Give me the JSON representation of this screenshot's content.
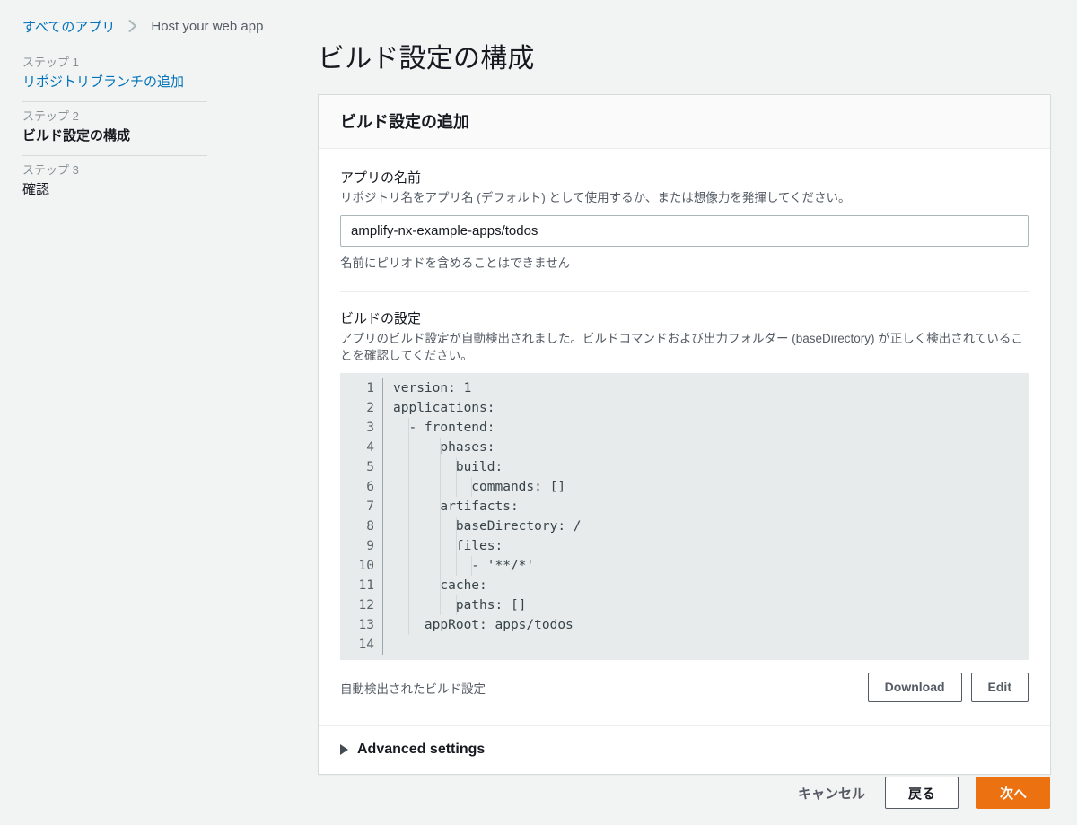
{
  "breadcrumb": {
    "root_label": "すべてのアプリ",
    "separator_icon": "chevron-right-icon",
    "current_label": "Host your web app"
  },
  "sidebar": {
    "steps": [
      {
        "number_label": "ステップ 1",
        "title": "リポジトリブランチの追加",
        "state": "link"
      },
      {
        "number_label": "ステップ 2",
        "title": "ビルド設定の構成",
        "state": "active"
      },
      {
        "number_label": "ステップ 3",
        "title": "確認",
        "state": "plain"
      }
    ]
  },
  "main": {
    "page_title": "ビルド設定の構成",
    "card": {
      "header_title": "ビルド設定の追加",
      "app_name": {
        "label": "アプリの名前",
        "description": "リポジトリ名をアプリ名 (デフォルト) として使用するか、または想像力を発揮してください。",
        "value": "amplify-nx-example-apps/todos",
        "placeholder": "アプリの名前",
        "hint": "名前にピリオドを含めることはできません"
      },
      "build_settings": {
        "label": "ビルドの設定",
        "description": "アプリのビルド設定が自動検出されました。ビルドコマンドおよび出力フォルダー (baseDirectory) が正しく検出されていることを確認してください。",
        "line_numbers": [
          "1",
          "2",
          "3",
          "4",
          "5",
          "6",
          "7",
          "8",
          "9",
          "10",
          "11",
          "12",
          "13",
          "14"
        ],
        "code_lines": [
          "version: 1",
          "applications:",
          "  - frontend:",
          "      phases:",
          "        build:",
          "          commands: []",
          "      artifacts:",
          "        baseDirectory: /",
          "        files:",
          "          - '**/*'",
          "      cache:",
          "        paths: []",
          "    appRoot: apps/todos",
          ""
        ],
        "footer_note": "自動検出されたビルド設定",
        "download_button": "Download",
        "edit_button": "Edit"
      },
      "advanced": {
        "caret_icon": "caret-right-icon",
        "label": "Advanced settings"
      }
    }
  },
  "footer": {
    "cancel_label": "キャンセル",
    "back_label": "戻る",
    "next_label": "次へ"
  },
  "colors": {
    "page_background": "#f2f3f3",
    "link": "#0073bb",
    "primary_button": "#ec7211",
    "editor_background": "#e7ebec",
    "border": "#d5dbdb",
    "muted_text": "#545b64"
  }
}
